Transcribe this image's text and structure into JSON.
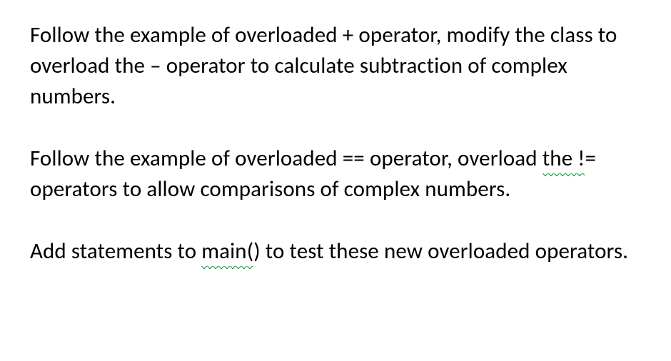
{
  "para1": {
    "t1": "Follow the example of overloaded ",
    "op1": "+",
    "t2": " operator, modify the class to overload the ",
    "op2": "–",
    "t3": " operator to calculate subtraction of complex numbers."
  },
  "para2": {
    "t1": "Follow the example of overloaded ",
    "op1": "==",
    "t2": " operator, overload ",
    "sq1_a": "the ",
    "sq1_b": "!",
    "op2_rest": "=",
    "t3": " operators to allow comparisons of complex numbers."
  },
  "para3": {
    "t1": "Add statements to ",
    "sq1": "main(",
    "t2": ")",
    "t3": " to test these new overloaded operators."
  }
}
